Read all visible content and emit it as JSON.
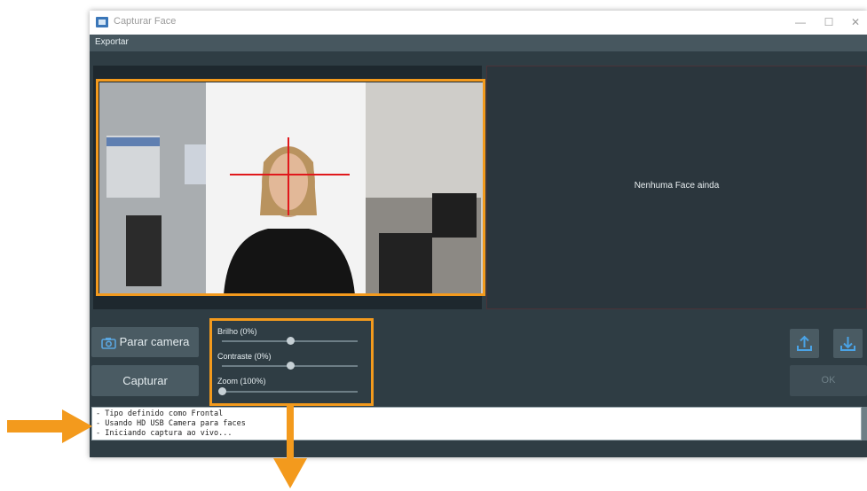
{
  "window": {
    "title": "Capturar Face",
    "controls": {
      "minimize": "—",
      "maximize": "☐",
      "close": "✕"
    }
  },
  "menu": {
    "items": [
      "Exportar"
    ]
  },
  "face_panel": {
    "empty_text": "Nenhuma Face ainda"
  },
  "buttons": {
    "stop_camera": "Parar camera",
    "capture": "Capturar",
    "upload_icon": "upload-icon",
    "download_icon": "download-icon",
    "ok": "OK"
  },
  "sliders": [
    {
      "label": "Brilho (0%)",
      "value": 0.5
    },
    {
      "label": "Contraste (0%)",
      "value": 0.5
    },
    {
      "label": "Zoom (100%)",
      "value": 0.0
    }
  ],
  "log": {
    "lines": [
      "- Tipo definido como Frontal",
      "- Usando HD USB Camera para faces",
      "- Iniciando captura ao vivo..."
    ]
  },
  "colors": {
    "highlight": "#f39a1d",
    "accent": "#3a8fd0",
    "window_bg": "#2f3d44"
  }
}
